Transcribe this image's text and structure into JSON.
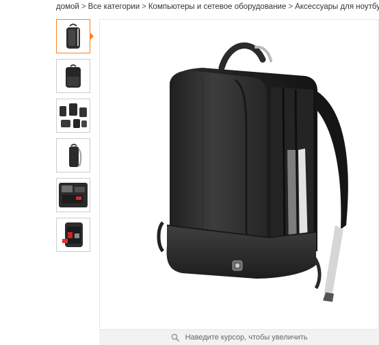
{
  "breadcrumb": {
    "items": [
      "домой",
      "Все категории",
      "Компьютеры и сетевое оборудование",
      "Аксессуары для ноутбуков"
    ],
    "separator": ">",
    "trailing": ">"
  },
  "gallery": {
    "thumbnails": [
      {
        "icon": "backpack-front-icon",
        "active": true
      },
      {
        "icon": "backpack-back-icon",
        "active": false
      },
      {
        "icon": "backpack-group-icon",
        "active": false
      },
      {
        "icon": "backpack-side-icon",
        "active": false
      },
      {
        "icon": "backpack-open-icon",
        "active": false
      },
      {
        "icon": "backpack-interior-icon",
        "active": false
      }
    ],
    "active_border_color": "#ff7e1a",
    "zoom_hint": "Наведите курсор, чтобы увеличить"
  }
}
